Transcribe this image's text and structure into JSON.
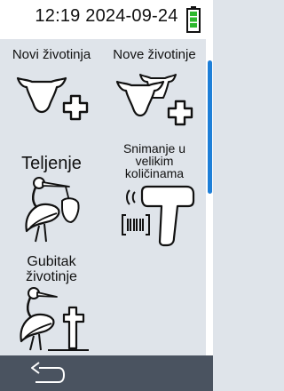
{
  "status": {
    "time": "12:19",
    "date": "2024-09-24",
    "battery_level": 1.0,
    "battery_color": "#2db82d"
  },
  "tiles": [
    {
      "label": "Novi životinja",
      "icon": "animal-add-icon"
    },
    {
      "label": "Nove životinje",
      "icon": "animals-add-icon"
    },
    {
      "label": "Teljenje",
      "icon": "stork-icon"
    },
    {
      "label": "Snimanje u velikim količinama",
      "icon": "barcode-scanner-icon"
    },
    {
      "label": "Gubitak životinje",
      "icon": "stork-cross-icon"
    }
  ],
  "tile3_lines": [
    "Snimanje u",
    "velikim",
    "količinama"
  ],
  "tile5_lines": [
    "Gubitak",
    "životinje"
  ],
  "footer": {
    "back_icon": "back-arrow-icon"
  },
  "colors": {
    "background": "#dfe4ea",
    "accent": "#1e7fd8",
    "footer": "#4a5360"
  }
}
